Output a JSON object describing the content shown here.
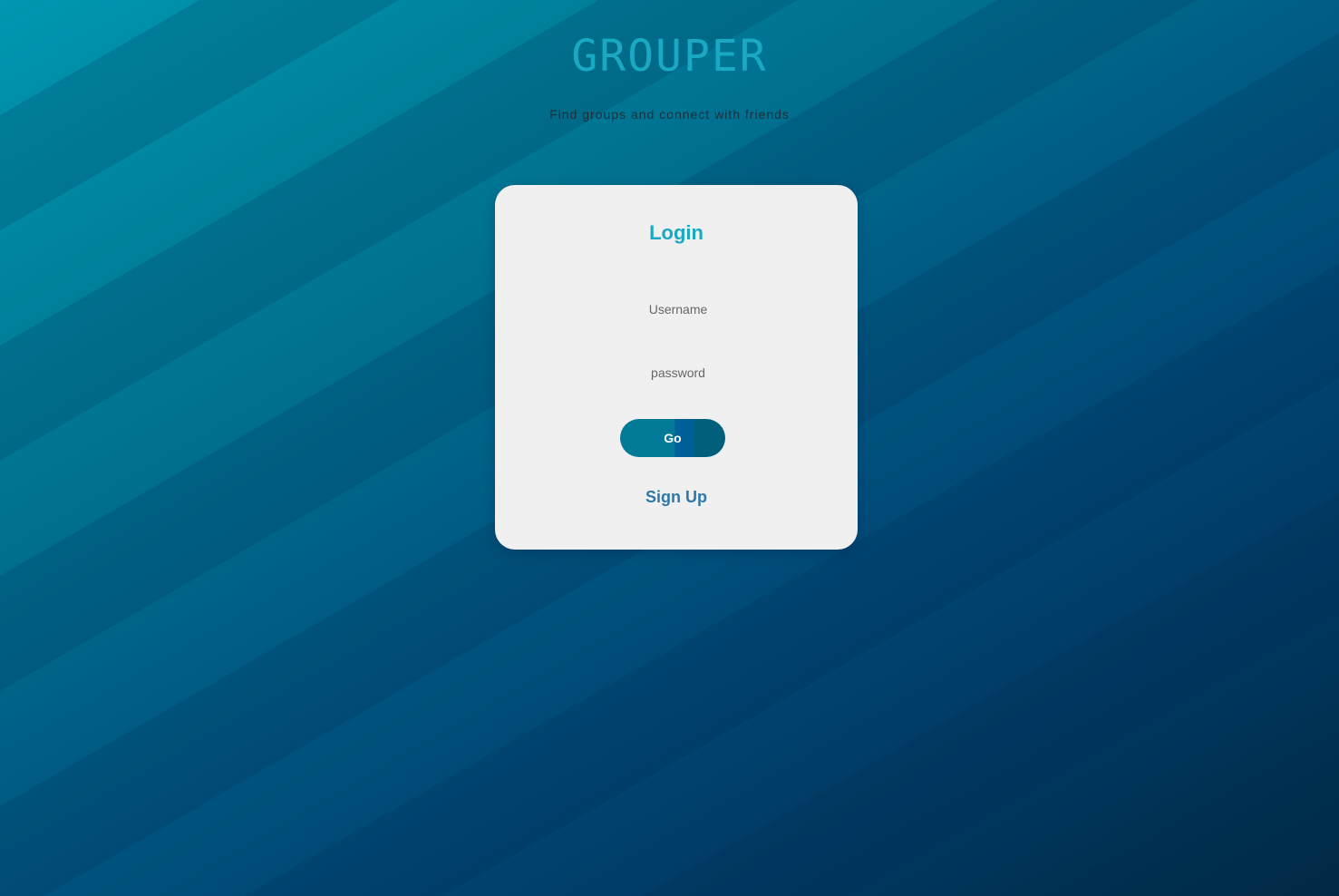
{
  "app": {
    "title": "GROUPER",
    "subtitle": "Find groups and connect with friends"
  },
  "login": {
    "heading": "Login",
    "username_placeholder": "Username",
    "password_placeholder": "password",
    "submit_label": "Go",
    "signup_label": "Sign Up"
  }
}
